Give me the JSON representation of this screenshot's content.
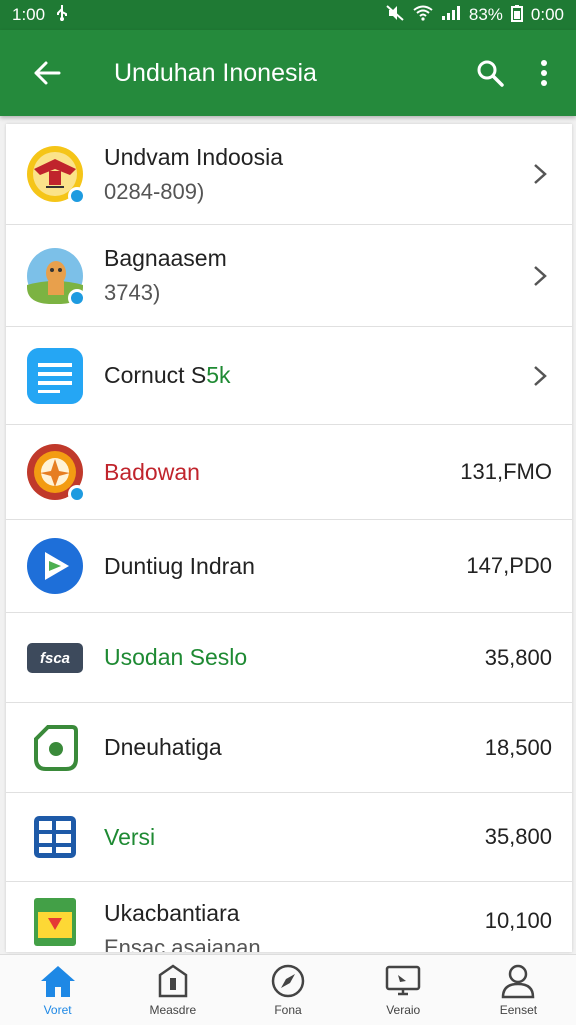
{
  "status": {
    "time": "1:00",
    "battery": "83%",
    "clock_right": "0:00"
  },
  "appbar": {
    "title": "Unduhan Inonesia"
  },
  "items": [
    {
      "name": "Undvam Indoosia",
      "sub": "0284-809)",
      "value": "",
      "accent": ""
    },
    {
      "name": "Bagnaasem",
      "sub": "3743)",
      "value": "",
      "accent": ""
    },
    {
      "name": "Cornuct S",
      "name_extra": "5k",
      "sub": "",
      "value": "",
      "accent": ""
    },
    {
      "name": "Badowan",
      "sub": "",
      "value": "131,FMO",
      "accent": "#c0242c"
    },
    {
      "name": "Duntiug Indran",
      "sub": "",
      "value": "147,PD0",
      "accent": ""
    },
    {
      "name": "Usodan Seslo",
      "sub": "",
      "value": "35,800",
      "accent": "#1e8a33",
      "icon_text": "fsca"
    },
    {
      "name": "Dneuhatiga",
      "sub": "",
      "value": "18,500",
      "accent": ""
    },
    {
      "name": "Versi",
      "sub": "",
      "value": "35,800",
      "accent": "#1e8a33"
    },
    {
      "name": "Ukacbantiara",
      "sub": "Ensac asaianan",
      "value": "10,100",
      "accent": ""
    }
  ],
  "nav": [
    {
      "label": "Voret",
      "icon": "home-icon"
    },
    {
      "label": "Measdre",
      "icon": "document-icon"
    },
    {
      "label": "Fona",
      "icon": "compass-icon"
    },
    {
      "label": "Veraio",
      "icon": "monitor-icon"
    },
    {
      "label": "Eenset",
      "icon": "person-icon"
    }
  ],
  "colors": {
    "primary": "#258a3c",
    "accent_blue": "#1e88e5",
    "red": "#c0242c"
  }
}
